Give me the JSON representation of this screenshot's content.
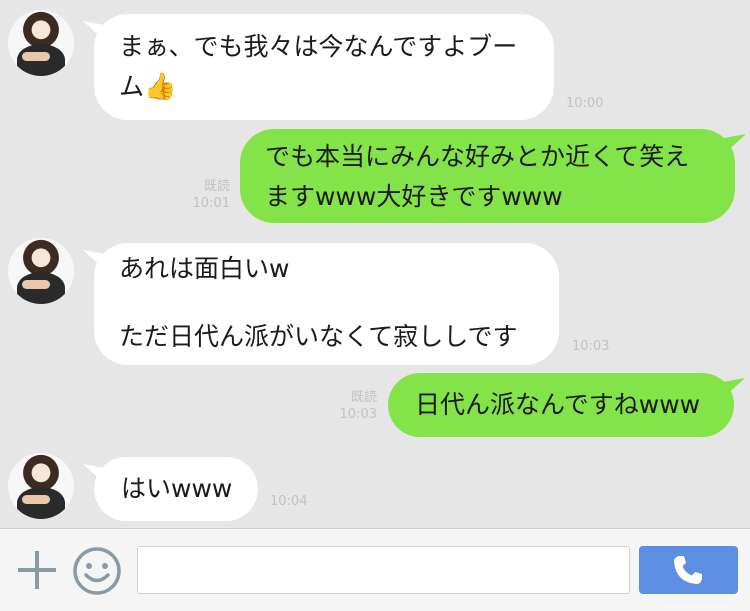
{
  "messages": [
    {
      "lines": [
        "まぁ、でも我々は今なんですよブー",
        "ム"
      ],
      "emoji": "👍",
      "time": "10:00"
    },
    {
      "lines": [
        "でも本当にみんな好みとか近くて笑え",
        "ますwww大好きですwww"
      ],
      "read": "既読",
      "time": "10:01"
    },
    {
      "lines": [
        "あれは面白いw",
        "",
        "ただ日代ん派がいなくて寂ししです"
      ],
      "time": "10:03"
    },
    {
      "lines": [
        "日代ん派なんですねwww"
      ],
      "read": "既読",
      "time": "10:03"
    },
    {
      "lines": [
        "はいwww"
      ],
      "time": "10:04"
    }
  ],
  "input": {
    "placeholder": "",
    "value": ""
  },
  "icons": {
    "add": "plus-icon",
    "sticker": "smiley-icon",
    "call": "phone-icon"
  },
  "colors": {
    "background": "#e6e6e6",
    "outgoing": "#83e349",
    "incoming": "#ffffff",
    "call_button": "#5c8ee2"
  }
}
